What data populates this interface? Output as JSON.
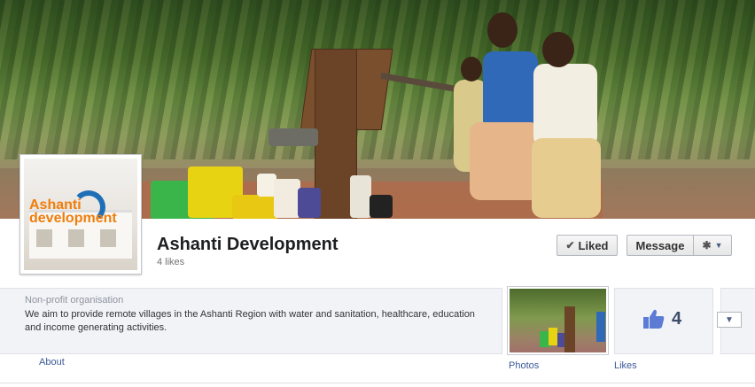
{
  "page": {
    "name": "Ashanti Development",
    "likes_text": "4 likes",
    "category": "Non-profit organisation",
    "description": "We aim to provide remote villages in the Ashanti Region with water and sanitation, healthcare, education and income generating activities."
  },
  "profile_logo": {
    "line1": "Ashanti",
    "line2": "development"
  },
  "actions": {
    "liked_label": "Liked",
    "message_label": "Message",
    "settings_icon": "gear-icon",
    "dropdown_icon": "chevron-down-icon"
  },
  "tabs": {
    "about_label": "About",
    "photos_label": "Photos",
    "likes_label": "Likes",
    "likes_count": "4"
  },
  "colors": {
    "link": "#3b5998",
    "logo_orange": "#f07d0c",
    "logo_blue": "#1f6fb6"
  }
}
